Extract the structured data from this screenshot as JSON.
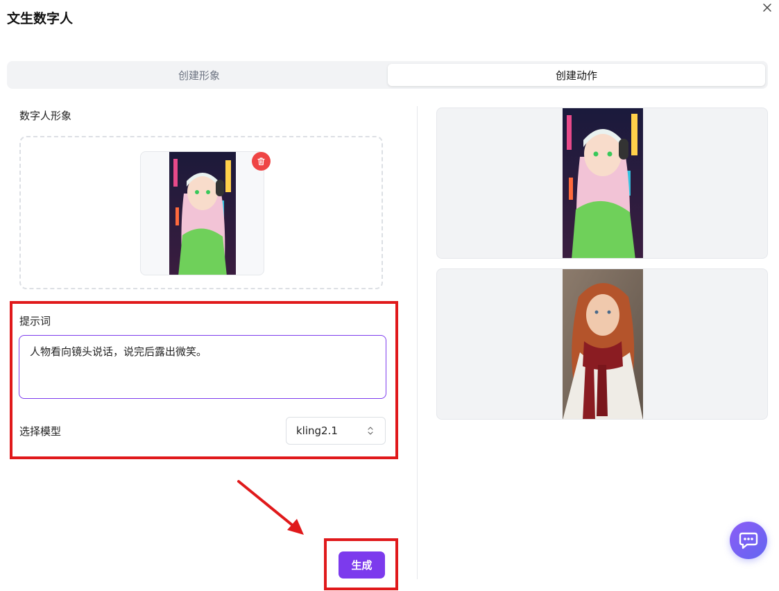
{
  "dialog": {
    "title": "文生数字人"
  },
  "tabs": [
    {
      "label": "创建形象",
      "active": false
    },
    {
      "label": "创建动作",
      "active": true
    }
  ],
  "avatar_section": {
    "label": "数字人形象"
  },
  "prompt": {
    "label": "提示词",
    "value": "人物看向镜头说话，说完后露出微笑。"
  },
  "model": {
    "label": "选择模型",
    "selected": "kling2.1"
  },
  "actions": {
    "generate_label": "生成"
  },
  "colors": {
    "accent": "#7c3aed",
    "annotation_red": "#e0191b",
    "delete_red": "#ef4444"
  },
  "icons": [
    "close-icon",
    "trash-icon",
    "chevron-up-down-icon",
    "chat-icon"
  ]
}
